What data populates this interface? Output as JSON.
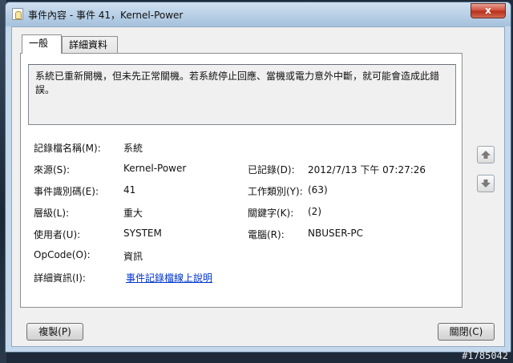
{
  "window": {
    "title": "事件內容 - 事件 41，Kernel-Power",
    "close_label": "x"
  },
  "tabs": [
    {
      "label": "一般",
      "active": true
    },
    {
      "label": "詳細資料",
      "active": false
    }
  ],
  "message": "系統已重新開機，但未先正常關機。若系統停止回應、當機或電力意外中斷，就可能會造成此錯誤。",
  "fields": {
    "log_name": {
      "label": "記錄檔名稱(M):",
      "value": "系統"
    },
    "source": {
      "label": "來源(S):",
      "value": "Kernel-Power"
    },
    "logged": {
      "label": "已記錄(D):",
      "value": "2012/7/13 下午 07:27:26"
    },
    "event_id": {
      "label": "事件識別碼(E):",
      "value": "41"
    },
    "task_category": {
      "label": "工作類別(Y):",
      "value": "(63)"
    },
    "level": {
      "label": "層級(L):",
      "value": "重大"
    },
    "keywords": {
      "label": "關鍵字(K):",
      "value": "(2)"
    },
    "user": {
      "label": "使用者(U):",
      "value": "SYSTEM"
    },
    "computer": {
      "label": "電腦(R):",
      "value": "NBUSER-PC"
    },
    "opcode": {
      "label": "OpCode(O):",
      "value": "資訊"
    },
    "more_info": {
      "label": "詳細資訊(I):",
      "link": "事件記錄檔線上說明"
    }
  },
  "buttons": {
    "copy": "複製(P)",
    "close": "關閉(C)"
  },
  "watermark": "#1785042",
  "colors": {
    "link": "#0033cc",
    "close_button": "#c8402c",
    "arrow_icon": "#7a7a7a"
  },
  "icons": {
    "nav_up": "up-arrow-icon",
    "nav_down": "down-arrow-icon",
    "title": "event-log-icon"
  }
}
